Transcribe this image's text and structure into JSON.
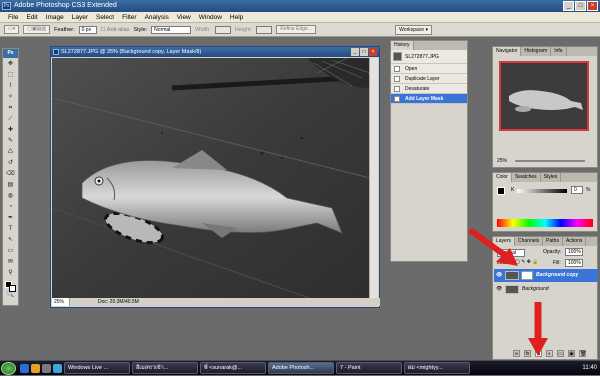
{
  "window": {
    "title": "Adobe Photoshop CS3 Extended",
    "logo_text": "Ps",
    "btn_min": "_",
    "btn_max": "□",
    "btn_close": "×"
  },
  "menu": [
    "File",
    "Edit",
    "Image",
    "Layer",
    "Select",
    "Filter",
    "Analysis",
    "View",
    "Window",
    "Help"
  ],
  "options": {
    "feather_label": "Feather:",
    "feather_value": "0 px",
    "antialias_label": "Anti-alias",
    "style_label": "Style:",
    "style_value": "Normal",
    "width_label": "Width:",
    "height_label": "Height:",
    "refine_edge": "Refine Edge...",
    "workspace": "Workspace ▾"
  },
  "document": {
    "title": "SL272877.JPG @ 25% (Background copy, Layer Mask/8)",
    "zoom": "25%",
    "doc_info": "Doc: 20.3M/40.5M",
    "btn_min": "_",
    "btn_max": "□",
    "btn_close": "×"
  },
  "history": {
    "tab": "History",
    "snapshot": "SL272877.JPG",
    "items": [
      {
        "label": "Open",
        "selected": false
      },
      {
        "label": "Duplicate Layer",
        "selected": false
      },
      {
        "label": "Desaturate",
        "selected": false
      },
      {
        "label": "Add Layer Mask",
        "selected": true
      }
    ]
  },
  "navigator": {
    "tabs": [
      "Navigator",
      "Histogram",
      "Info"
    ],
    "zoom": "25%"
  },
  "color": {
    "tabs": [
      "Color",
      "Swatches",
      "Styles"
    ],
    "channel": "K",
    "value": "0",
    "unit": "%"
  },
  "layers": {
    "tabs": [
      "Layers",
      "Channels",
      "Paths",
      "Actions"
    ],
    "blend": "Normal",
    "opacity_label": "Opacity:",
    "opacity_value": "100%",
    "lock_label": "Lock:",
    "fill_label": "Fill:",
    "fill_value": "100%",
    "rows": [
      {
        "name": "Background copy",
        "selected": true
      },
      {
        "name": "Background",
        "selected": false
      }
    ],
    "buttons": [
      "link",
      "fx",
      "mask",
      "adjust",
      "folder",
      "new",
      "trash"
    ]
  },
  "taskbar": {
    "items": [
      {
        "label": "Windows Live ...",
        "active": false
      },
      {
        "label": "อีเมลขาเข้า...",
        "active": false
      },
      {
        "label": "พี่ <sunarak@...",
        "active": false
      },
      {
        "label": "Adobe Photosh...",
        "active": true
      },
      {
        "label": "7 - Paint",
        "active": false
      },
      {
        "label": "ผม <mightyy...",
        "active": false
      }
    ],
    "clock": "11:40"
  },
  "icons": {
    "tools": [
      "move-tool-icon",
      "marquee-tool-icon",
      "lasso-tool-icon",
      "magic-wand-icon",
      "crop-tool-icon",
      "slice-tool-icon",
      "healing-brush-icon",
      "brush-tool-icon",
      "clone-stamp-icon",
      "history-brush-icon",
      "eraser-tool-icon",
      "gradient-tool-icon",
      "blur-tool-icon",
      "dodge-tool-icon",
      "pen-tool-icon",
      "type-tool-icon",
      "path-select-icon",
      "shape-tool-icon",
      "notes-tool-icon",
      "eyedropper-icon",
      "hand-tool-icon",
      "zoom-tool-icon"
    ]
  },
  "colors": {
    "selection": "#3b74d8",
    "arrow": "#e02020"
  }
}
